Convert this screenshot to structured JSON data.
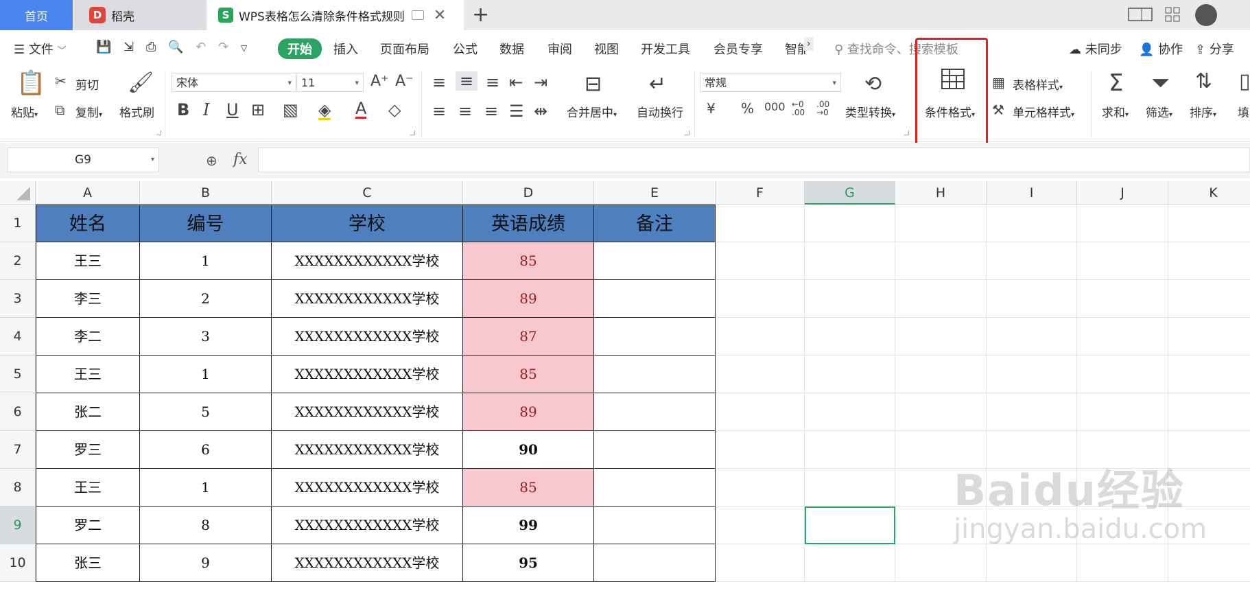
{
  "tabs": {
    "home": "首页",
    "daoke": "稻壳",
    "doc_title": "WPS表格怎么清除条件格式规则"
  },
  "menu": {
    "file": "文件",
    "items": [
      "开始",
      "插入",
      "页面布局",
      "公式",
      "数据",
      "审阅",
      "视图",
      "开发工具",
      "会员专享",
      "智能"
    ],
    "search_placeholder": "查找命令、搜索模板",
    "sync": "未同步",
    "collab": "协作",
    "share": "分享"
  },
  "ribbon": {
    "paste": "粘贴",
    "cut": "剪切",
    "copy": "复制",
    "format_painter": "格式刷",
    "font_name": "宋体",
    "font_size": "11",
    "merge_center": "合并居中",
    "wrap_text": "自动换行",
    "number_format": "常规",
    "type_convert": "类型转换",
    "cond_format": "条件格式",
    "table_style": "表格样式",
    "cell_style": "单元格样式",
    "sum": "求和",
    "filter": "筛选",
    "sort": "排序",
    "fill": "填"
  },
  "formula_bar": {
    "name_box": "G9",
    "fx": "fx",
    "value": ""
  },
  "grid": {
    "columns": [
      "A",
      "B",
      "C",
      "D",
      "E",
      "F",
      "G",
      "H",
      "I",
      "J",
      "K"
    ],
    "rows": [
      "1",
      "2",
      "3",
      "4",
      "5",
      "6",
      "7",
      "8",
      "9",
      "10"
    ],
    "selected_cell": "G9",
    "header": [
      "姓名",
      "编号",
      "学校",
      "英语成绩",
      "备注"
    ],
    "data": [
      [
        "王三",
        "1",
        "XXXXXXXXXXXX学校",
        "85",
        ""
      ],
      [
        "李三",
        "2",
        "XXXXXXXXXXXX学校",
        "89",
        ""
      ],
      [
        "李二",
        "3",
        "XXXXXXXXXXXX学校",
        "87",
        ""
      ],
      [
        "王三",
        "1",
        "XXXXXXXXXXXX学校",
        "85",
        ""
      ],
      [
        "张二",
        "5",
        "XXXXXXXXXXXX学校",
        "89",
        ""
      ],
      [
        "罗三",
        "6",
        "XXXXXXXXXXXX学校",
        "90",
        ""
      ],
      [
        "王三",
        "1",
        "XXXXXXXXXXXX学校",
        "85",
        ""
      ],
      [
        "罗二",
        "8",
        "XXXXXXXXXXXX学校",
        "99",
        ""
      ],
      [
        "张三",
        "9",
        "XXXXXXXXXXXX学校",
        "95",
        ""
      ]
    ],
    "highlighted_rows": [
      0,
      1,
      2,
      3,
      4,
      6
    ],
    "colors": {
      "header_fill": "#4e7fbe",
      "highlight_fill": "#f9c7ce",
      "highlight_text": "#9c1a1c",
      "accent": "#2aa364"
    }
  },
  "watermark": {
    "line1": "Baidu经验",
    "line2": "jingyan.baidu.com"
  }
}
